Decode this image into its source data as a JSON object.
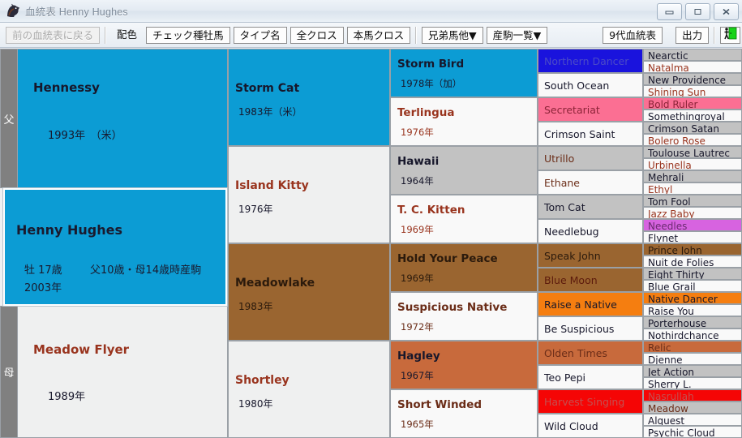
{
  "window": {
    "title": "血統表 Henny Hughes",
    "icon": "horse-head-icon",
    "minimize_label": "最小化",
    "maximize_label": "最大化",
    "close_label": "閉じる"
  },
  "toolbar": {
    "back_button": "前の血統表に戻る",
    "color_label": "配色",
    "check_stallion": "チェック種牡馬",
    "type_name": "タイプ名",
    "all_cross": "全クロス",
    "main_cross": "本馬クロス",
    "siblings": "兄弟馬他▼",
    "offspring": "産駒一覧▼",
    "nine_gen": "9代血統表",
    "output": "出力",
    "exit_icon": "exit-door-icon"
  },
  "pedigree": {
    "sire_strip_label": "父",
    "dam_strip_label": "母",
    "main_horse": {
      "name": "Henny Hughes",
      "sex_age": "牡 17歳",
      "note": "父10歳・母14歳時産駒",
      "year": "2003年",
      "color": "#0c9cd4"
    },
    "gen1": [
      {
        "name": "Hennessy",
        "year": "1993年　（米）",
        "bg": "#0c9cd4",
        "fg": "#17172b"
      },
      {
        "name": "Meadow Flyer",
        "year": "1989年",
        "bg": "#eff0f0",
        "fg": "#99341e"
      }
    ],
    "gen2": [
      {
        "name": "Storm Cat",
        "year": "1983年（米）",
        "bg": "#0c9cd4",
        "fg": "#17172b"
      },
      {
        "name": "Island Kitty",
        "year": "1976年",
        "bg": "#eff0f0",
        "fg": "#99341e"
      },
      {
        "name": "Meadowlake",
        "year": "1983年",
        "bg": "#9a6530",
        "fg": "#2b1a0c"
      },
      {
        "name": "Shortley",
        "year": "1980年",
        "bg": "#eff0f0",
        "fg": "#99341e"
      }
    ],
    "gen3": [
      {
        "name": "Storm Bird",
        "year": "1978年（加）",
        "bg": "#0c9cd4",
        "fg": "#17172b"
      },
      {
        "name": "Terlingua",
        "year": "1976年",
        "bg": "#f9f9f9",
        "fg": "#99341e"
      },
      {
        "name": "Hawaii",
        "year": "1964年",
        "bg": "#c2c2c2",
        "fg": "#17172b"
      },
      {
        "name": "T. C. Kitten",
        "year": "1969年",
        "bg": "#f9f9f9",
        "fg": "#99341e"
      },
      {
        "name": "Hold Your Peace",
        "year": "1969年",
        "bg": "#9a6530",
        "fg": "#2b1a0c"
      },
      {
        "name": "Suspicious Native",
        "year": "1972年",
        "bg": "#f9f9f9",
        "fg": "#6b2d18"
      },
      {
        "name": "Hagley",
        "year": "1967年",
        "bg": "#c86a3c",
        "fg": "#17172b"
      },
      {
        "name": "Short Winded",
        "year": "1965年",
        "bg": "#f9f9f9",
        "fg": "#6b2d18"
      }
    ],
    "gen4": [
      {
        "name": "Northern Dancer",
        "bg": "#1a13dd",
        "fg": "#4b4bc7"
      },
      {
        "name": "South Ocean",
        "bg": "#f9f9f9",
        "fg": "#17172b"
      },
      {
        "name": "Secretariat",
        "bg": "#fb6f93",
        "fg": "#8c2438"
      },
      {
        "name": "Crimson Saint",
        "bg": "#f9f9f9",
        "fg": "#17172b"
      },
      {
        "name": "Utrillo",
        "bg": "#c2c2c2",
        "fg": "#6b2d18"
      },
      {
        "name": "Ethane",
        "bg": "#f9f9f9",
        "fg": "#6b2d18"
      },
      {
        "name": "Tom Cat",
        "bg": "#c2c2c2",
        "fg": "#17172b"
      },
      {
        "name": "Needlebug",
        "bg": "#f9f9f9",
        "fg": "#17172b"
      },
      {
        "name": "Speak John",
        "bg": "#9a6530",
        "fg": "#2b1a0c"
      },
      {
        "name": "Blue Moon",
        "bg": "#9a6530",
        "fg": "#5c1a0c"
      },
      {
        "name": "Raise a Native",
        "bg": "#f57e10",
        "fg": "#17172b"
      },
      {
        "name": "Be Suspicious",
        "bg": "#f9f9f9",
        "fg": "#17172b"
      },
      {
        "name": "Olden Times",
        "bg": "#c86a3c",
        "fg": "#6b2d18"
      },
      {
        "name": "Teo Pepi",
        "bg": "#f9f9f9",
        "fg": "#17172b"
      },
      {
        "name": "Harvest Singing",
        "bg": "#f50505",
        "fg": "#c45050"
      },
      {
        "name": "Wild Cloud",
        "bg": "#f9f9f9",
        "fg": "#17172b"
      }
    ],
    "gen5": [
      {
        "name": "Nearctic",
        "bg": "#c2c2c2",
        "fg": "#17172b"
      },
      {
        "name": "Natalma",
        "bg": "#f9f9f9",
        "fg": "#99341e"
      },
      {
        "name": "New Providence",
        "bg": "#c2c2c2",
        "fg": "#17172b"
      },
      {
        "name": "Shining Sun",
        "bg": "#f9f9f9",
        "fg": "#99341e"
      },
      {
        "name": "Bold Ruler",
        "bg": "#fb6f93",
        "fg": "#8c2438"
      },
      {
        "name": "Somethingroyal",
        "bg": "#f9f9f9",
        "fg": "#17172b"
      },
      {
        "name": "Crimson Satan",
        "bg": "#c2c2c2",
        "fg": "#17172b"
      },
      {
        "name": "Bolero Rose",
        "bg": "#f9f9f9",
        "fg": "#99341e"
      },
      {
        "name": "Toulouse Lautrec",
        "bg": "#c2c2c2",
        "fg": "#17172b"
      },
      {
        "name": "Urbinella",
        "bg": "#f9f9f9",
        "fg": "#99341e"
      },
      {
        "name": "Mehrali",
        "bg": "#c2c2c2",
        "fg": "#17172b"
      },
      {
        "name": "Ethyl",
        "bg": "#f9f9f9",
        "fg": "#99341e"
      },
      {
        "name": "Tom Fool",
        "bg": "#c2c2c2",
        "fg": "#17172b"
      },
      {
        "name": "Jazz Baby",
        "bg": "#f9f9f9",
        "fg": "#99341e"
      },
      {
        "name": "Needles",
        "bg": "#d763e0",
        "fg": "#6b2a70"
      },
      {
        "name": "Flynet",
        "bg": "#f9f9f9",
        "fg": "#17172b"
      },
      {
        "name": "Prince John",
        "bg": "#9a6530",
        "fg": "#2b1a0c"
      },
      {
        "name": "Nuit de Folies",
        "bg": "#f9f9f9",
        "fg": "#17172b"
      },
      {
        "name": "Eight Thirty",
        "bg": "#c2c2c2",
        "fg": "#17172b"
      },
      {
        "name": "Blue Grail",
        "bg": "#f9f9f9",
        "fg": "#17172b"
      },
      {
        "name": "Native Dancer",
        "bg": "#f57e10",
        "fg": "#17172b"
      },
      {
        "name": "Raise You",
        "bg": "#f9f9f9",
        "fg": "#17172b"
      },
      {
        "name": "Porterhouse",
        "bg": "#c2c2c2",
        "fg": "#17172b"
      },
      {
        "name": "Nothirdchance",
        "bg": "#f9f9f9",
        "fg": "#17172b"
      },
      {
        "name": "Relic",
        "bg": "#c86a3c",
        "fg": "#6b2d18"
      },
      {
        "name": "Djenne",
        "bg": "#f9f9f9",
        "fg": "#17172b"
      },
      {
        "name": "Jet Action",
        "bg": "#c2c2c2",
        "fg": "#17172b"
      },
      {
        "name": "Sherry L.",
        "bg": "#f9f9f9",
        "fg": "#17172b"
      },
      {
        "name": "Nasrullah",
        "bg": "#f50505",
        "fg": "#c45050"
      },
      {
        "name": "Meadow",
        "bg": "#c2c2c2",
        "fg": "#6b2d18"
      },
      {
        "name": "Alquest",
        "bg": "#f9f9f9",
        "fg": "#17172b"
      },
      {
        "name": "Psychic Cloud",
        "bg": "#f9f9f9",
        "fg": "#17172b"
      }
    ]
  }
}
